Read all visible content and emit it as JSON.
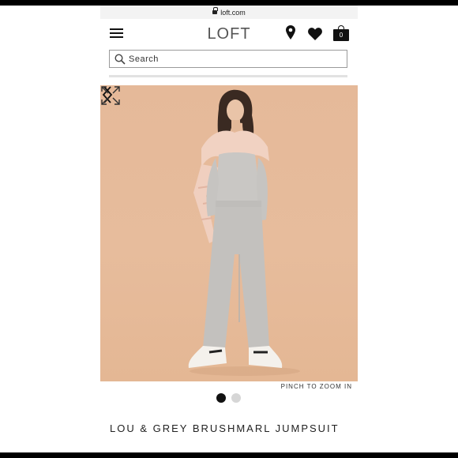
{
  "browser": {
    "url": "loft.com"
  },
  "header": {
    "logo": "LOFT",
    "cart_count": "0",
    "icons": [
      "menu-icon",
      "store-locator-icon",
      "favorites-icon",
      "shopping-bag-icon"
    ]
  },
  "search": {
    "placeholder": "Search"
  },
  "gallery": {
    "zoom_hint": "PINCH TO ZOOM IN",
    "image_count": 2,
    "active_index": 0
  },
  "product": {
    "title": "LOU & GREY BRUSHMARL JUMPSUIT"
  },
  "colors": {
    "background": "#e5b999",
    "text": "#222222",
    "active_dot": "#111111",
    "inactive_dot": "#d6d6d6"
  }
}
